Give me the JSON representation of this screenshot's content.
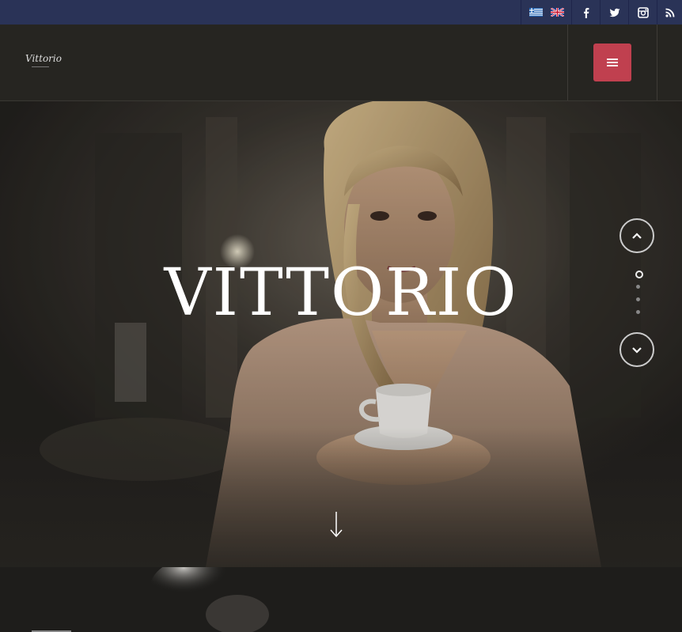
{
  "topbar": {
    "languages": [
      "greek-flag",
      "uk-flag"
    ],
    "social": [
      "facebook-icon",
      "twitter-icon",
      "instagram-icon",
      "rss-icon"
    ],
    "background_color": "#2a3357"
  },
  "header": {
    "logo_text": "Vittorio",
    "menu_icon": "hamburger-icon",
    "menu_button_color": "#c0404f"
  },
  "hero": {
    "title": "VITTORIO",
    "slides_total": 4,
    "active_slide": 1,
    "prev_icon": "chevron-up-icon",
    "next_icon": "chevron-down-icon",
    "scroll_icon": "arrow-down-icon"
  }
}
